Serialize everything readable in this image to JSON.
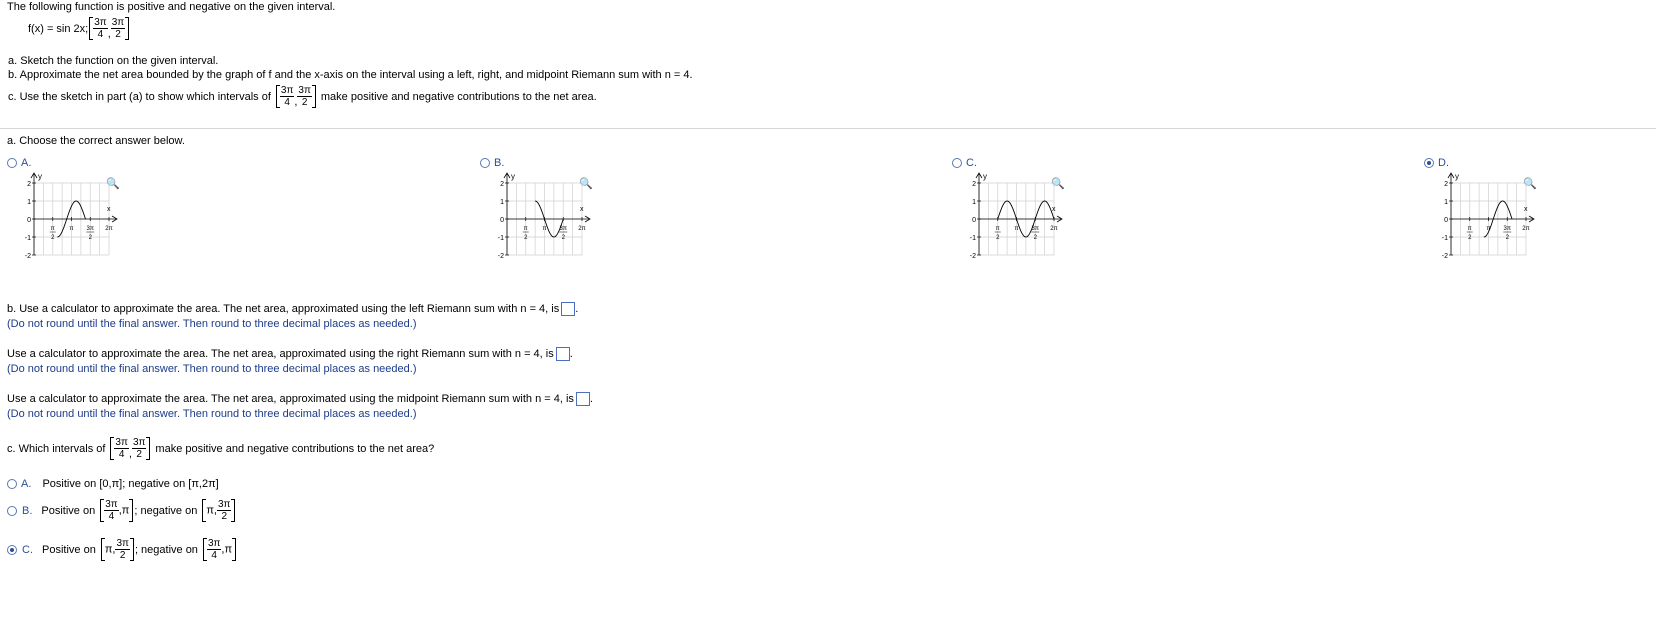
{
  "problem": {
    "intro": "The following function is positive and negative on the given interval.",
    "function_label": "f(x) = sin 2x;",
    "interval": {
      "a_num": "3π",
      "a_den": "4",
      "b_num": "3π",
      "b_den": "2"
    },
    "part_a": "a. Sketch the function on the given interval.",
    "part_b": "b. Approximate the net area bounded by the graph of f and the x-axis on the interval using a left, right, and midpoint Riemann sum with n = 4.",
    "part_c_pre": "c. Use the sketch in part (a) to show which intervals of",
    "part_c_post": "make positive and negative contributions to the net area."
  },
  "section_a": {
    "prompt": "a. Choose the correct answer below.",
    "options": [
      {
        "letter": "A.",
        "selected": false
      },
      {
        "letter": "B.",
        "selected": false
      },
      {
        "letter": "C.",
        "selected": false
      },
      {
        "letter": "D.",
        "selected": true
      }
    ],
    "graph": {
      "y_label": "y",
      "x_label": "x",
      "y_ticks": [
        "2",
        "1",
        "0",
        "-1",
        "-2"
      ],
      "x_tick_pi": "π",
      "x_tick_two": "2",
      "x_tick_3pi": "3π",
      "x_tick_2pi": "2π"
    }
  },
  "section_b": {
    "left_text": "b. Use a calculator to approximate the area. The net area, approximated using the left Riemann sum with n = 4, is",
    "left_note": "(Do not round until the final answer. Then round to three decimal places as needed.)",
    "right_text": "Use a calculator to approximate the area. The net area, approximated using the right Riemann sum with n = 4, is",
    "right_note": "(Do not round until the final answer. Then round to three decimal places as needed.)",
    "mid_text": "Use a calculator to approximate the area. The net area, approximated using the midpoint Riemann sum with n = 4, is",
    "mid_note": "(Do not round until the final answer. Then round to three decimal places as needed.)"
  },
  "section_c": {
    "prompt_pre": "c. Which intervals of",
    "prompt_post": "make positive and negative contributions to the net area?",
    "options": [
      {
        "letter": "A.",
        "selected": false,
        "text": "Positive on [0,π]; negative on [π,2π]"
      },
      {
        "letter": "B.",
        "selected": false,
        "pos_label": "Positive on",
        "neg_label": "; negative on",
        "pos_num": "3π",
        "pos_den": "4",
        "pos_tail": ",π",
        "neg_head": "π,",
        "neg_num": "3π",
        "neg_den": "2"
      },
      {
        "letter": "C.",
        "selected": true,
        "pos_label": "Positive on",
        "neg_label": "; negative on",
        "pos_head": "π,",
        "pos_num": "3π",
        "pos_den": "2",
        "neg_num": "3π",
        "neg_den": "4",
        "neg_tail": ",π"
      }
    ]
  },
  "icons": {
    "magnifier": "magnifier-icon"
  },
  "colors": {
    "accent": "#2a4e9a",
    "note_text": "#1c3b8a",
    "divider": "#d6d6d6"
  }
}
